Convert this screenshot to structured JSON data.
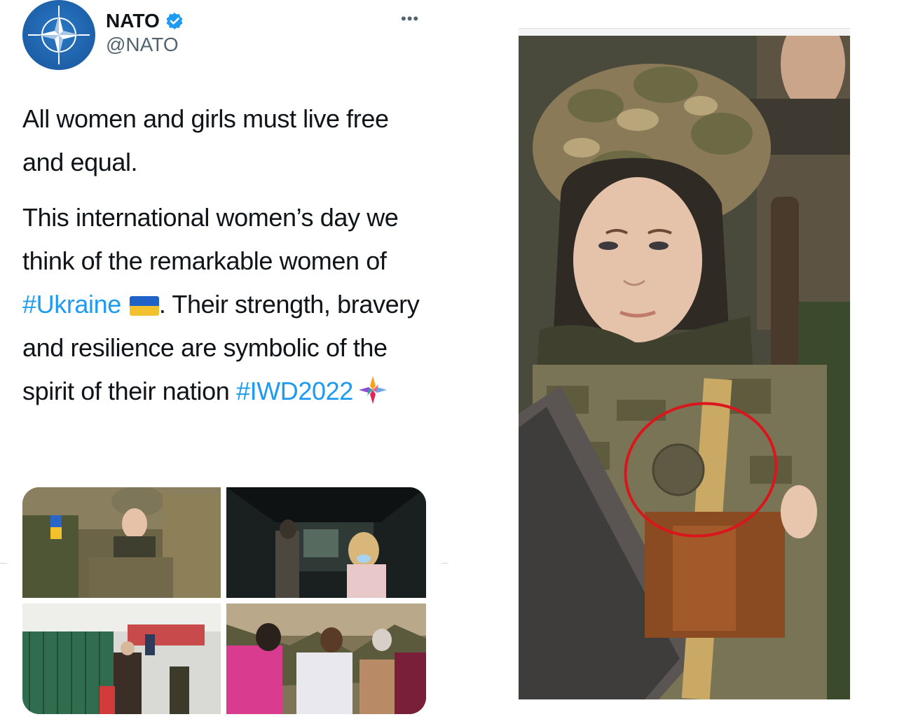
{
  "tweet": {
    "display_name": "NATO",
    "handle": "@NATO",
    "more_label": "•••",
    "paragraph1": "All women and girls must live free and equal.",
    "p2_a": "This international women’s day we think of the remarkable women of ",
    "hashtag_ukraine": "#Ukraine",
    "p2_b": ". Their strength, bravery and resilience are symbolic of the spirit of their nation ",
    "hashtag_iwd": "#IWD2022"
  },
  "colors": {
    "hashtag": "#1d9bf0",
    "verified": "#1d9bf0",
    "circle_annotation": "#d9161c"
  },
  "icons": [
    "nato-logo-icon",
    "verified-badge-icon",
    "more-options-icon",
    "ukraine-flag-icon",
    "iwd-emoji-icon"
  ]
}
